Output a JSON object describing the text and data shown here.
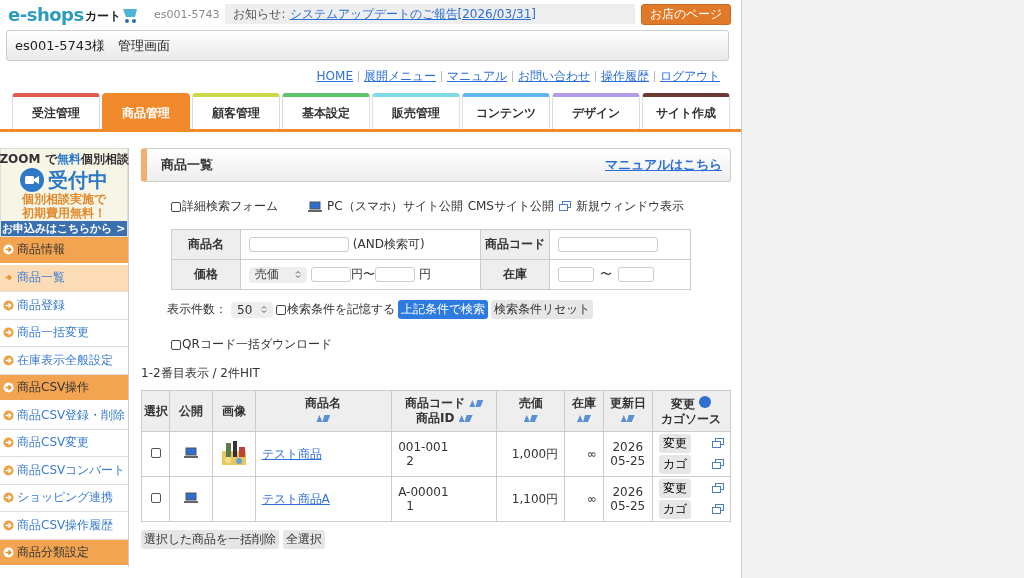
{
  "header": {
    "logo": {
      "main": "e-shops",
      "sub": "カート"
    },
    "account_id": "es001-5743",
    "notice_label": "お知らせ:",
    "notice_link": "システムアップデートのご報告[2026/03/31]",
    "shop_button": "お店のページ"
  },
  "title_bar": "es001-5743様　管理画面",
  "top_links": [
    "HOME",
    "展開メニュー",
    "マニュアル",
    "お問い合わせ",
    "操作履歴",
    "ログアウト"
  ],
  "tabs": [
    {
      "label": "受注管理",
      "selected": false,
      "color": "#e05a4f"
    },
    {
      "label": "商品管理",
      "selected": true,
      "color": "#f08a2c"
    },
    {
      "label": "顧客管理",
      "selected": false,
      "color": "#c8d94a"
    },
    {
      "label": "基本設定",
      "selected": false,
      "color": "#5cc36a"
    },
    {
      "label": "販売管理",
      "selected": false,
      "color": "#7fdbe8"
    },
    {
      "label": "コンテンツ",
      "selected": false,
      "color": "#5fb6ee"
    },
    {
      "label": "デザイン",
      "selected": false,
      "color": "#b49be6"
    },
    {
      "label": "サイト作成",
      "selected": false,
      "color": "#6b3a33"
    }
  ],
  "banner": {
    "line1_a": "ZOOM で",
    "line1_b": "無料",
    "line1_c": "個別相談",
    "line2": "受付中",
    "line3": "個別相談実施で",
    "line4": "初期費用無料！",
    "footer": "お申込みはこちらから >"
  },
  "sidebar": [
    {
      "kind": "heading",
      "label": "商品情報",
      "selected": false
    },
    {
      "kind": "link",
      "label": "商品一覧",
      "selected": true
    },
    {
      "kind": "link",
      "label": "商品登録",
      "selected": false
    },
    {
      "kind": "link",
      "label": "商品一括変更",
      "selected": false
    },
    {
      "kind": "link",
      "label": "在庫表示全般設定",
      "selected": false
    },
    {
      "kind": "heading",
      "label": "商品CSV操作",
      "selected": false
    },
    {
      "kind": "link",
      "label": "商品CSV登録・削除",
      "selected": false
    },
    {
      "kind": "link",
      "label": "商品CSV変更",
      "selected": false
    },
    {
      "kind": "link",
      "label": "商品CSVコンバート",
      "selected": false
    },
    {
      "kind": "link",
      "label": "ショッピング連携",
      "selected": false
    },
    {
      "kind": "link",
      "label": "商品CSV操作履歴",
      "selected": false
    },
    {
      "kind": "heading",
      "label": "商品分類設定",
      "selected": false
    }
  ],
  "page_title": "商品一覧",
  "manual_link": "マニュアルはこちら",
  "options": {
    "detail_form": {
      "label": "詳細検索フォーム",
      "checked": false
    },
    "legend_pc": "PC（スマホ）サイト公開",
    "legend_cms": "CMSサイト公開",
    "legend_window": "新規ウィンドウ表示"
  },
  "search": {
    "name_label": "商品名",
    "name_hint": "(AND検索可)",
    "code_label": "商品コード",
    "price_label": "価格",
    "price_select": "売価",
    "yen_from": "円〜",
    "yen_to": "円",
    "stock_label": "在庫",
    "tilde": "〜"
  },
  "count_label": "表示件数：",
  "count_value": "50",
  "remember": {
    "label": "検索条件を記憶する",
    "checked": false
  },
  "search_button": "上記条件で検索",
  "reset_button": "検索条件リセット",
  "qr": {
    "label": "QRコード一括ダウンロード",
    "checked": false
  },
  "hit_text": "1-2番目表示 / 2件HIT",
  "table": {
    "columns": [
      "選択",
      "公開",
      "画像",
      "商品名",
      "商品コード",
      "商品ID",
      "売価",
      "在庫",
      "更新日",
      "変更",
      "カゴソース"
    ],
    "rows": [
      {
        "selected": false,
        "has_image": true,
        "name": "テスト商品",
        "code": "001-001",
        "id": "2",
        "price": "1,000円",
        "stock": "∞",
        "date_year": "2026",
        "date_day": "05-25",
        "edit": "変更",
        "cart": "カゴ"
      },
      {
        "selected": false,
        "has_image": false,
        "name": "テスト商品A",
        "code": "A-00001",
        "id": "1",
        "price": "1,100円",
        "stock": "∞",
        "date_year": "2026",
        "date_day": "05-25",
        "edit": "変更",
        "cart": "カゴ"
      }
    ]
  },
  "bulk_delete": "選択した商品を一括削除",
  "select_all": "全選択"
}
